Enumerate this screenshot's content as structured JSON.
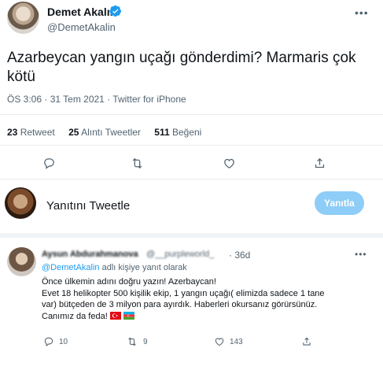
{
  "tweet": {
    "author_name": "Demet Akalın",
    "author_handle": "@DemetAkalin",
    "text": "Azarbeycan yangın uçağı gönderdimi? Marmaris çok kötü",
    "meta": "ÖS 3:06 · 31 Tem 2021 · Twitter for iPhone",
    "stats": {
      "retweets_count": "23",
      "retweets_label": "Retweet",
      "quotes_count": "25",
      "quotes_label": "Alıntı Tweetler",
      "likes_count": "511",
      "likes_label": "Beğeni"
    },
    "actions": [
      "reply-icon",
      "retweet-icon",
      "like-icon",
      "share-icon"
    ]
  },
  "composer": {
    "placeholder": "Yanıtını Tweetle",
    "button_label": "Yanıtla"
  },
  "reply": {
    "author_name": "Aysun Abdurahmanova",
    "author_handle": "@__purpleworld_",
    "time": "· 36d",
    "replying_to_handle": "@DemetAkalin",
    "replying_to_suffix": " adlı kişiye yanıt olarak",
    "line1": "Önce ülkemin adını doğru yazın! Azerbaycan!",
    "line2": "Evet 18 helikopter 500 kişilik ekip, 1 yangın uçağı( elimizda sadece 1 tane var) bütçeden de 3 milyon para ayırdık. Haberleri okursanız görürsünüz.",
    "line3": "Canımız da feda!",
    "flags": [
      "turkey-flag",
      "azerbaijan-flag"
    ],
    "reply_count": "10",
    "retweet_count": "9",
    "like_count": "143"
  },
  "colors": {
    "accent": "#1d9bf0",
    "reply_button_disabled": "#8ecdf7",
    "secondary_text": "#536471"
  }
}
